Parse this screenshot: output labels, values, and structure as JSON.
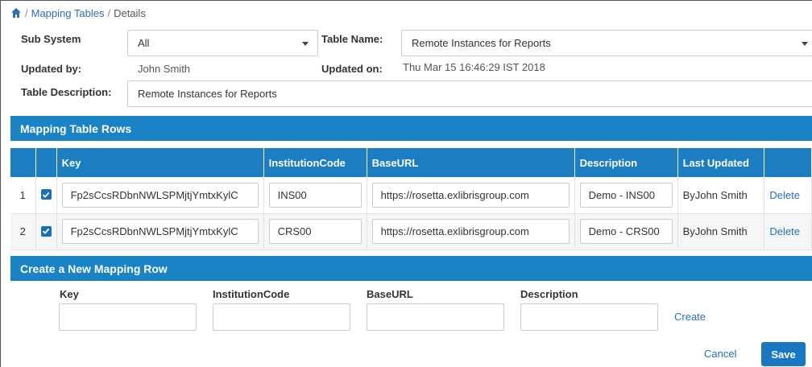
{
  "breadcrumb": {
    "home_icon": "home-icon",
    "separator": "/",
    "mapping_tables": "Mapping Tables",
    "current": "Details"
  },
  "form": {
    "sub_system_label": "Sub System",
    "sub_system_value": "All",
    "table_name_label": "Table Name:",
    "table_name_value": "Remote Instances for Reports",
    "updated_by_label": "Updated by:",
    "updated_by_value": "John Smith",
    "updated_on_label": "Updated on:",
    "updated_on_value": "Thu Mar 15 16:46:29 IST 2018",
    "description_label": "Table Description:",
    "description_value": "Remote Instances for Reports"
  },
  "rows_section": {
    "title": "Mapping Table Rows",
    "columns": [
      "Key",
      "InstitutionCode",
      "BaseURL",
      "Description",
      "Last Updated"
    ],
    "rows": [
      {
        "num": "1",
        "key": "Fp2sCcsRDbnNWLSPMjtjYmtxKylC",
        "institution": "INS00",
        "base_url": "https://rosetta.exlibrisgroup.com",
        "description": "Demo - INS00",
        "last_updated": "ByJohn Smith",
        "action": "Delete"
      },
      {
        "num": "2",
        "key": "Fp2sCcsRDbnNWLSPMjtjYmtxKylC",
        "institution": "CRS00",
        "base_url": "https://rosetta.exlibrisgroup.com",
        "description": "Demo - CRS00",
        "last_updated": "ByJohn Smith",
        "action": "Delete"
      }
    ]
  },
  "new_row": {
    "title": "Create a New Mapping Row",
    "key_label": "Key",
    "institution_label": "InstitutionCode",
    "base_url_label": "BaseURL",
    "description_label": "Description",
    "create_label": "Create"
  },
  "actions": {
    "cancel_label": "Cancel",
    "save_label": "Save"
  },
  "colors": {
    "accent": "#1a83c6",
    "header": "#1c7ec0",
    "link": "#2a6fb0"
  }
}
